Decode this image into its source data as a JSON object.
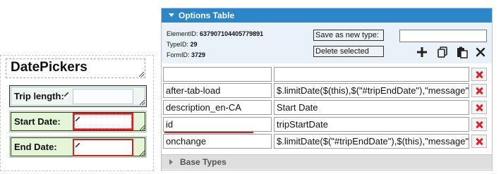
{
  "designer": {
    "title": "DatePickers",
    "fields": [
      {
        "label": "Trip length:"
      },
      {
        "label": "Start Date:"
      },
      {
        "label": "End Date:"
      }
    ]
  },
  "options_panel": {
    "title": "Options Table",
    "element_id_label": "ElementID:",
    "element_id": "637907104405779891",
    "type_id_label": "TypeID:",
    "type_id": "29",
    "form_id_label": "FormID:",
    "form_id": "3729",
    "save_as_new_label": "Save as new type:",
    "delete_selected_label": "Delete selected",
    "save_as_new_value": "",
    "rows": [
      {
        "key": "",
        "value": ""
      },
      {
        "key": "after-tab-load",
        "value": "$.limitDate($(this),$(\"#tripEndDate\"),\"message\""
      },
      {
        "key": "description_en-CA",
        "value": "Start Date"
      },
      {
        "key": "id",
        "value": "tripStartDate"
      },
      {
        "key": "onchange",
        "value": "$.limitDate($(\"#tripEndDate\"),$(this),\"message\""
      }
    ],
    "toolbar_icons": [
      "plus-icon",
      "copy-icon",
      "paste-icon",
      "close-icon"
    ]
  },
  "base_types": {
    "title": "Base Types"
  },
  "colors": {
    "header_blue": "#2c86c8",
    "highlight_red": "#d41f24",
    "field_green": "#e4f5d8"
  }
}
